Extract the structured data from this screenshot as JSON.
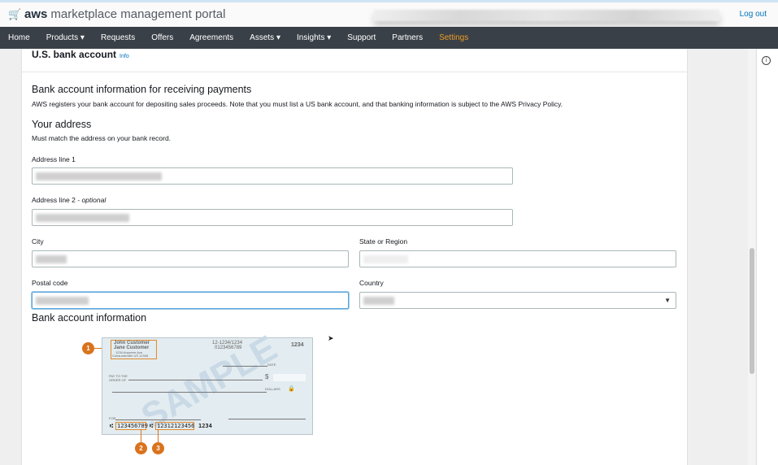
{
  "header": {
    "brand_bold": "aws",
    "brand_rest": "marketplace management portal",
    "logout": "Log out"
  },
  "nav": [
    {
      "label": "Home"
    },
    {
      "label": "Products ▾"
    },
    {
      "label": "Requests"
    },
    {
      "label": "Offers"
    },
    {
      "label": "Agreements"
    },
    {
      "label": "Assets ▾"
    },
    {
      "label": "Insights ▾"
    },
    {
      "label": "Support"
    },
    {
      "label": "Partners"
    },
    {
      "label": "Settings",
      "active": true
    }
  ],
  "section": {
    "title": "U.S. bank account",
    "info": "Info"
  },
  "bank_info": {
    "title": "Bank account information for receiving payments",
    "desc": "AWS registers your bank account for depositing sales proceeds. Note that you must list a US bank account, and that banking information is subject to the AWS Privacy Policy."
  },
  "address": {
    "title": "Your address",
    "desc": "Must match the address on your bank record.",
    "address1_label": "Address line 1",
    "address2_label": "Address line 2",
    "optional": "- optional",
    "city_label": "City",
    "state_label": "State or Region",
    "postal_label": "Postal code",
    "country_label": "Country"
  },
  "bank_account": {
    "title": "Bank account information"
  },
  "check": {
    "name1": "John Customer",
    "name2": "Jane Customer",
    "addr1": "1234 Anywere Ave",
    "addr2": "Consumerville US 12345",
    "routing_top": "12-1234/1234",
    "acct_top": "0123456789",
    "check_no": "1234",
    "date": "DATE",
    "pay_to": "PAY TO THE ORDER OF",
    "dollar": "$",
    "dollars": "DOLLARS",
    "for": "FOR",
    "watermark": "SAMPLE",
    "micr_routing": "123456789",
    "micr_account": "12312123456",
    "micr_check": "1234",
    "badges": [
      "1",
      "2",
      "3"
    ]
  }
}
